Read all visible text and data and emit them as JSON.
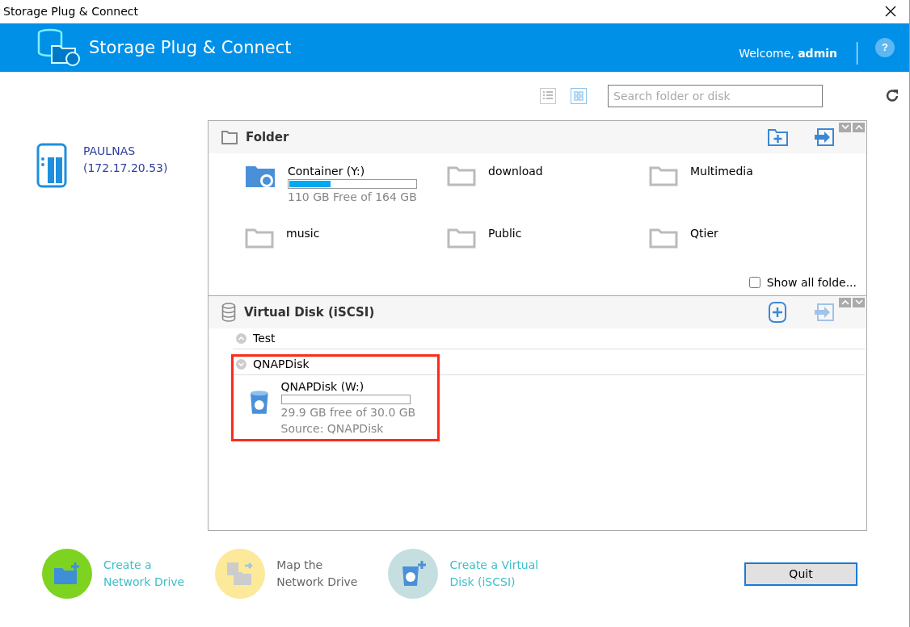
{
  "window": {
    "title": "Storage Plug & Connect"
  },
  "header": {
    "title": "Storage Plug & Connect",
    "welcome": "Welcome, ",
    "user": "admin",
    "help": "?"
  },
  "device": {
    "name": "PAULNAS",
    "address": "(172.17.20.53)"
  },
  "toolbar": {
    "views": [
      {
        "kind": "list",
        "selected": false
      },
      {
        "kind": "grid",
        "selected": true
      }
    ],
    "search": {
      "placeholder": "Search folder or disk"
    }
  },
  "folder_section": {
    "title": "Folder",
    "folders": [
      {
        "kind": "drive",
        "name": "Container (Y:)",
        "level": 0.33,
        "detail": "110 GB Free of 164 GB"
      },
      {
        "kind": "folder",
        "name": "download"
      },
      {
        "kind": "folder",
        "name": "Multimedia"
      },
      {
        "kind": "folder",
        "name": "music"
      },
      {
        "kind": "folder",
        "name": "Public"
      },
      {
        "kind": "folder",
        "name": "Qtier"
      }
    ],
    "show_all": {
      "label": "Show all folde...",
      "checked": false
    }
  },
  "disk_section": {
    "title": "Virtual Disk (iSCSI)",
    "groups": [
      {
        "name": "Test",
        "expanded": false,
        "highlighted": false
      },
      {
        "name": "QNAPDisk",
        "expanded": true,
        "highlighted": true,
        "disks": [
          {
            "name": "QNAPDisk (W:)",
            "level": 0,
            "detail": "29.9 GB free of 30.0 GB",
            "source": "Source: QNAPDisk"
          }
        ]
      }
    ]
  },
  "actions": [
    {
      "kind": "create-drive",
      "lines": [
        "Create a",
        "Network Drive"
      ],
      "color": "#7ed321",
      "disabled": false
    },
    {
      "kind": "map-drive",
      "lines": [
        "Map the",
        "Network Drive"
      ],
      "color": "#fde99a",
      "disabled": true
    },
    {
      "kind": "create-disk",
      "lines": [
        "Create a Virtual",
        "Disk (iSCSI)"
      ],
      "color": "#c5dfe0",
      "disabled": false
    }
  ],
  "quit": "Quit"
}
